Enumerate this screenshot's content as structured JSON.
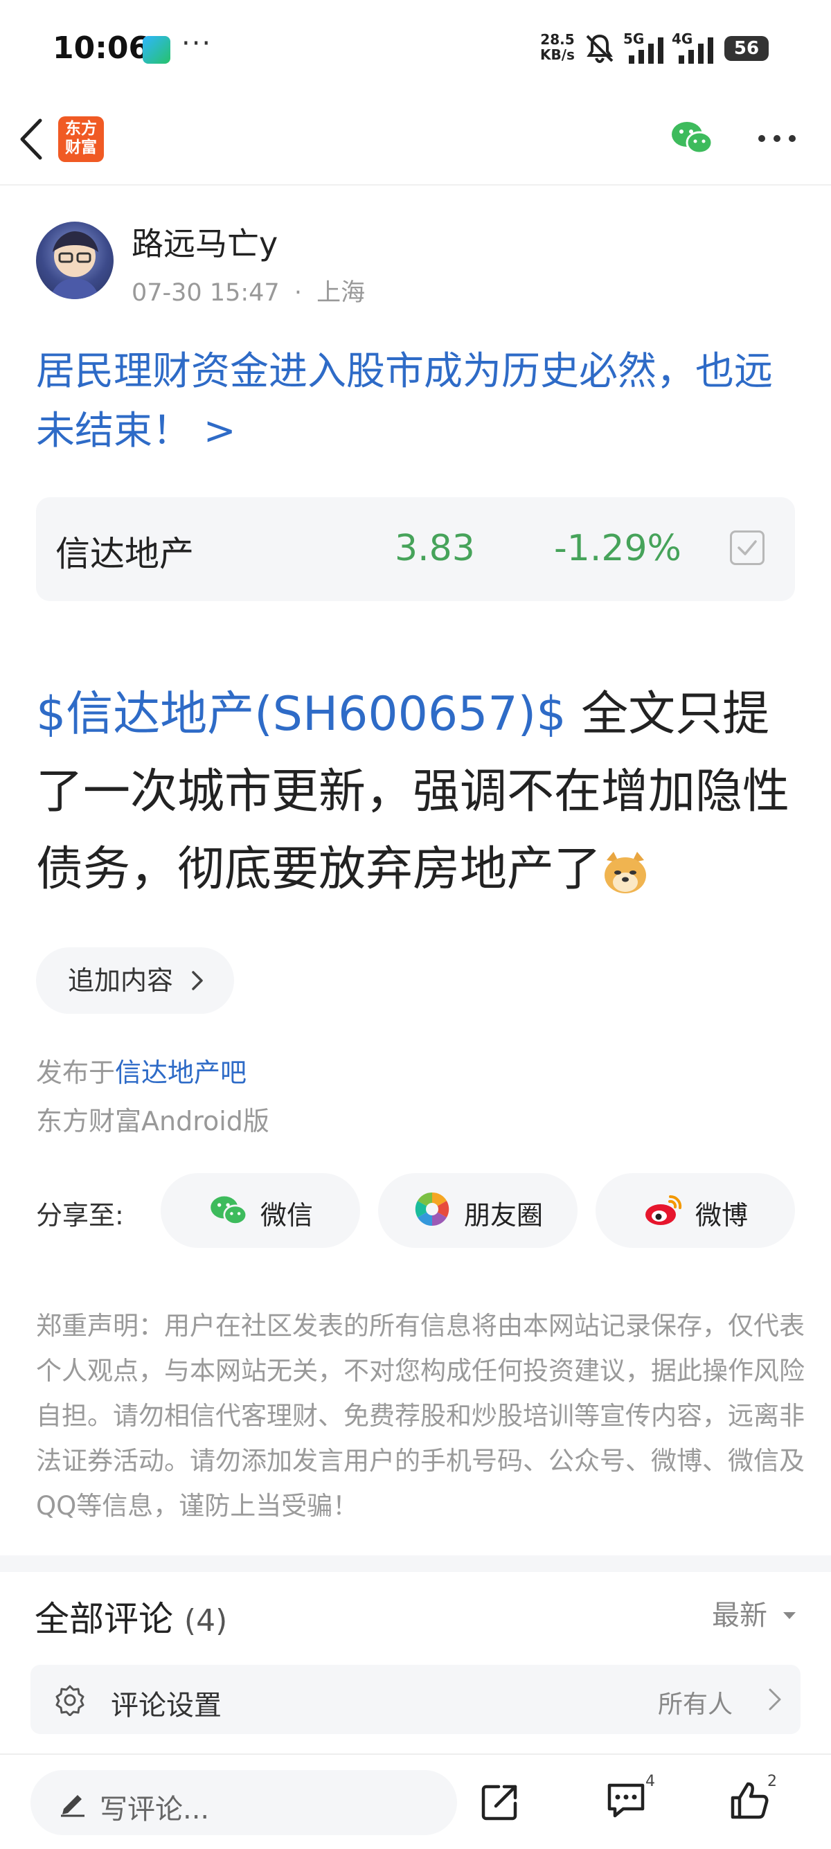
{
  "status_bar": {
    "time": "10:06",
    "overflow": "···",
    "net_speed_value": "28.5",
    "net_speed_unit": "KB/s",
    "sim1": "5G",
    "sim2": "4G",
    "battery": "56"
  },
  "header": {
    "logo_line1": "东方",
    "logo_line2": "财富",
    "icons": [
      "back-icon",
      "wechat-icon",
      "more-icon"
    ]
  },
  "author": {
    "name": "路远马亡y",
    "time": "07-30 15:47",
    "separator": "·",
    "location": "上海"
  },
  "post": {
    "title": "居民理财资金进入股市成为历史必然，也远未结束！ >",
    "stock_card": {
      "name": "信达地产",
      "price": "3.83",
      "change": "-1.29%"
    },
    "stock_link": "$信达地产(SH600657)$",
    "body_text": " 全文只提了一次城市更新，强调不在增加隐性债务，彻底要放弃房地产了",
    "append_label": "追加内容",
    "published_prefix": "发布于",
    "forum_name": "信达地产吧",
    "client": "东方财富Android版"
  },
  "share": {
    "label": "分享至:",
    "targets": [
      {
        "label": "微信",
        "icon": "wechat-icon"
      },
      {
        "label": "朋友圈",
        "icon": "moments-icon"
      },
      {
        "label": "微博",
        "icon": "weibo-icon"
      }
    ]
  },
  "disclaimer": "郑重声明：用户在社区发表的所有信息将由本网站记录保存，仅代表个人观点，与本网站无关，不对您构成任何投资建议，据此操作风险自担。请勿相信代客理财、免费荐股和炒股培训等宣传内容，远离非法证券活动。请勿添加发言用户的手机号码、公众号、微博、微信及QQ等信息，谨防上当受骗！",
  "comments": {
    "title": "全部评论",
    "count": "(4)",
    "sort": "最新",
    "settings_label": "评论设置",
    "settings_value": "所有人"
  },
  "bottom_bar": {
    "input_placeholder": "写评论...",
    "comment_count": "4",
    "like_count": "2"
  },
  "colors": {
    "link_blue": "#2e6bc7",
    "stock_green": "#46a35a",
    "brand_orange": "#f05a24",
    "wechat_green": "#3dbb5c",
    "weibo_red": "#e6162d"
  }
}
